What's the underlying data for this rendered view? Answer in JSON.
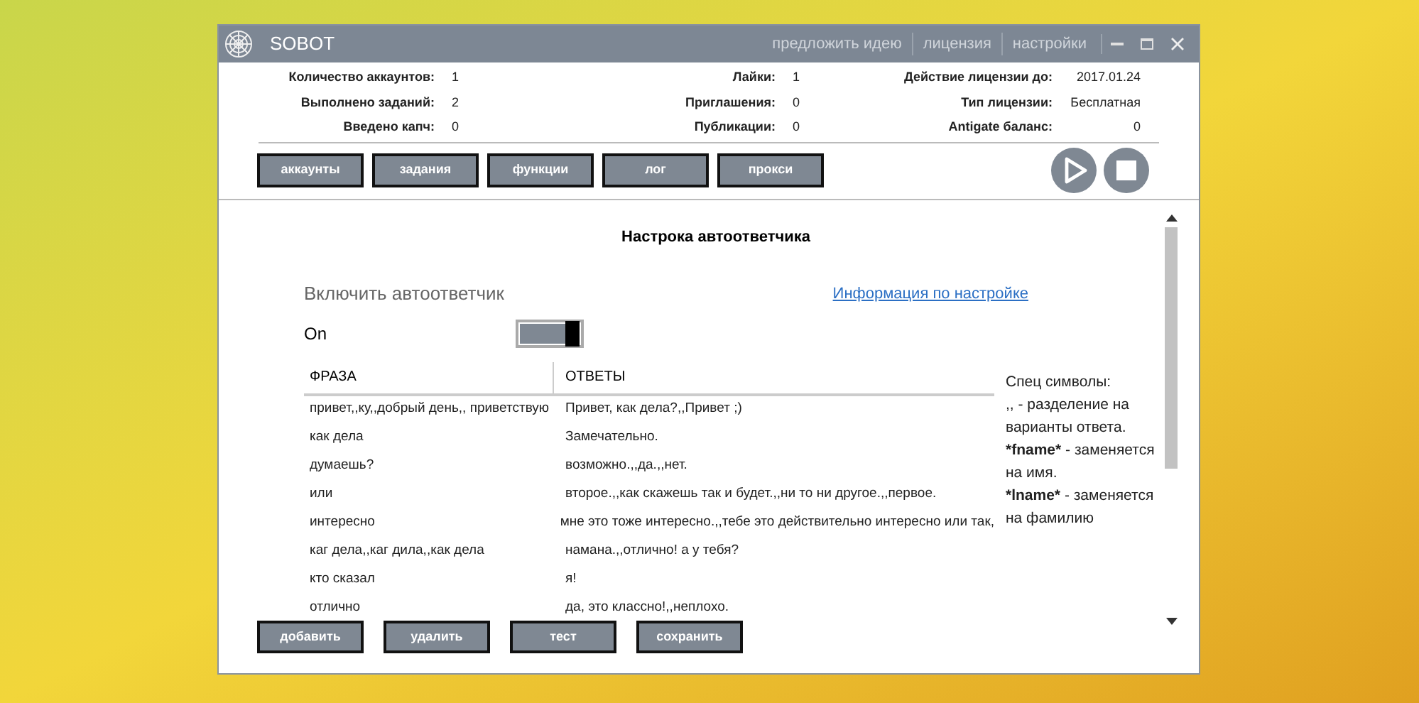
{
  "window": {
    "title": "SOBOT",
    "header_links": [
      "предложить идею",
      "лицензия",
      "настройки"
    ]
  },
  "stats": [
    [
      {
        "label": "Количество аккаунтов:",
        "value": "1"
      },
      {
        "label": "Выполнено заданий:",
        "value": "2"
      },
      {
        "label": "Введено капч:",
        "value": "0"
      }
    ],
    [
      {
        "label": "Лайки:",
        "value": "1"
      },
      {
        "label": "Приглашения:",
        "value": "0"
      },
      {
        "label": "Публикации:",
        "value": "0"
      }
    ],
    [
      {
        "label": "Действие лицензии до:",
        "value": "2017.01.24"
      },
      {
        "label": "Тип лицензии:",
        "value": "Бесплатная"
      },
      {
        "label": "Antigate баланс:",
        "value": "0"
      }
    ]
  ],
  "nav_buttons": [
    "аккаунты",
    "задания",
    "функции",
    "лог",
    "прокси"
  ],
  "section_title": "Настрока автоответчика",
  "enable_label": "Включить автоответчик",
  "info_link": "Информация по настройке",
  "toggle": {
    "label": "On",
    "on": true
  },
  "table": {
    "columns": [
      "ФРАЗА",
      "ОТВЕТЫ"
    ],
    "rows": [
      [
        "привет,,ку,,добрый день,, приветствую",
        "Привет, как дела?,,Привет ;)"
      ],
      [
        "как дела",
        "Замечательно."
      ],
      [
        "думаешь?",
        "возможно.,,да.,,нет."
      ],
      [
        "или",
        "второе.,,как скажешь так и будет.,,ни то ни другое.,,первое."
      ],
      [
        "интересно",
        "мне это тоже интересно.,,тебе это действительно интересно или так,"
      ],
      [
        "каг дела,,каг дила,,как дела",
        "намана.,,отлично! а у тебя?"
      ],
      [
        "кто сказал",
        "я!"
      ],
      [
        "отлично",
        "да, это классно!,,неплохо."
      ]
    ]
  },
  "help": {
    "title": "Спец символы:",
    "entries": [
      {
        "symbol": ",,",
        "description": " - разделение на варианты ответа.",
        "bold": false
      },
      {
        "symbol": "*fname*",
        "description": " - заменяется на имя.",
        "bold": true
      },
      {
        "symbol": "*lname*",
        "description": " - заменяется на фамилию",
        "bold": true
      }
    ]
  },
  "bottom_buttons": [
    "добавить",
    "удалить",
    "тест",
    "сохранить"
  ]
}
